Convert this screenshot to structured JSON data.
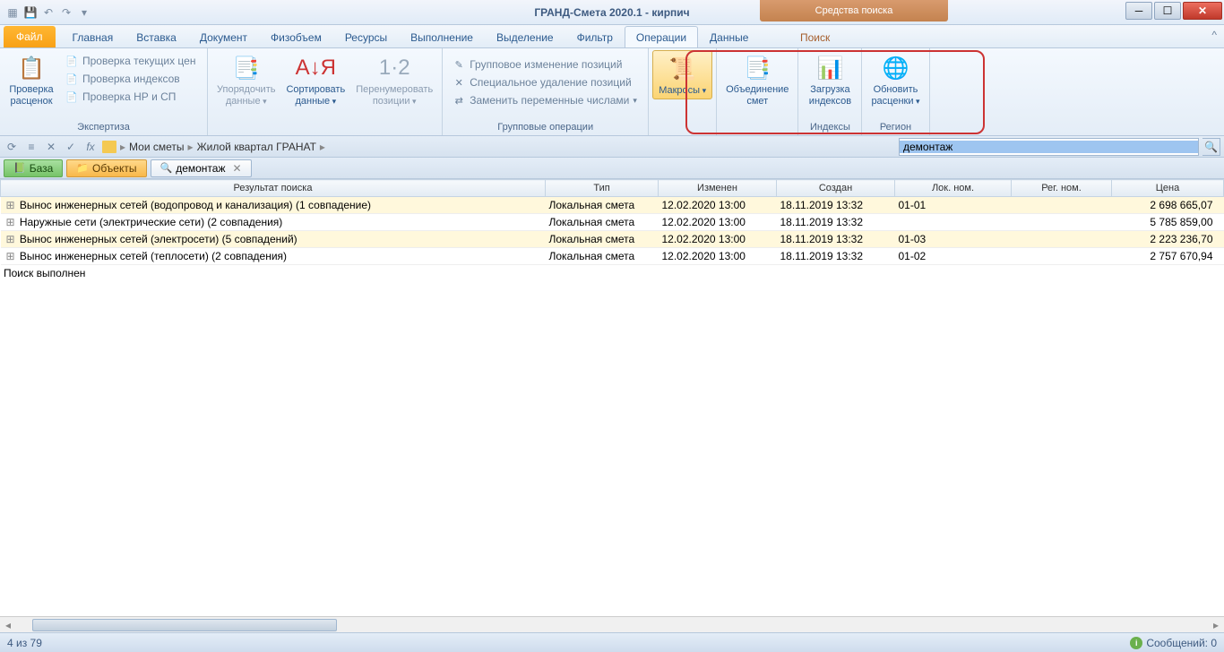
{
  "title": "ГРАНД-Смета 2020.1 -  кирпич",
  "contextual_tab_group": "Средства поиска",
  "tabs": {
    "file": "Файл",
    "items": [
      "Главная",
      "Вставка",
      "Документ",
      "Физобъем",
      "Ресурсы",
      "Выполнение",
      "Выделение",
      "Фильтр",
      "Операции",
      "Данные"
    ],
    "contextual": "Поиск",
    "active_index": 8
  },
  "ribbon": {
    "group_expertise": {
      "label": "Экспертиза",
      "big": "Проверка\nрасценок",
      "small": [
        "Проверка текущих цен",
        "Проверка индексов",
        "Проверка НР и СП"
      ]
    },
    "group_ops_single": [
      {
        "label": "Упорядочить\nданные"
      },
      {
        "label": "Сортировать\nданные"
      },
      {
        "label": "Перенумеровать\nпозиции"
      }
    ],
    "group_groupops": {
      "label": "Групповые операции",
      "small": [
        "Групповое изменение позиций",
        "Специальное удаление позиций",
        "Заменить переменные числами"
      ]
    },
    "group_macros": {
      "label": "Макросы"
    },
    "group_merge": {
      "label": "Объединение\nсмет"
    },
    "group_indexes": {
      "label": "Индексы",
      "big": "Загрузка\nиндексов"
    },
    "group_region": {
      "label": "Регион",
      "big": "Обновить\nрасценки"
    }
  },
  "breadcrumb": [
    "Мои сметы",
    "Жилой квартал ГРАНАТ"
  ],
  "search_value": "демонтаж",
  "view_tabs": {
    "base": "База",
    "objects": "Объекты",
    "search": "демонтаж"
  },
  "columns": [
    "Результат поиска",
    "Тип",
    "Изменен",
    "Создан",
    "Лок. ном.",
    "Рег. ном.",
    "Цена"
  ],
  "rows": [
    {
      "name": "Вынос инженерных сетей (водопровод и канализация) (1 совпадение)",
      "type": "Локальная смета",
      "modified": "12.02.2020 13:00",
      "created": "18.11.2019 13:32",
      "loc": "01-01",
      "reg": "",
      "price": "2 698 665,07"
    },
    {
      "name": "Наружные сети (электрические сети) (2 совпадения)",
      "type": "Локальная смета",
      "modified": "12.02.2020 13:00",
      "created": "18.11.2019 13:32",
      "loc": "",
      "reg": "",
      "price": "5 785 859,00"
    },
    {
      "name": "Вынос инженерных сетей (электросети) (5 совпадений)",
      "type": "Локальная смета",
      "modified": "12.02.2020 13:00",
      "created": "18.11.2019 13:32",
      "loc": "01-03",
      "reg": "",
      "price": "2 223 236,70"
    },
    {
      "name": "Вынос инженерных сетей (теплосети) (2 совпадения)",
      "type": "Локальная смета",
      "modified": "12.02.2020 13:00",
      "created": "18.11.2019 13:32",
      "loc": "01-02",
      "reg": "",
      "price": "2 757 670,94"
    }
  ],
  "search_done": "Поиск выполнен",
  "status_left": "4 из 79",
  "status_right": "Сообщений: 0"
}
